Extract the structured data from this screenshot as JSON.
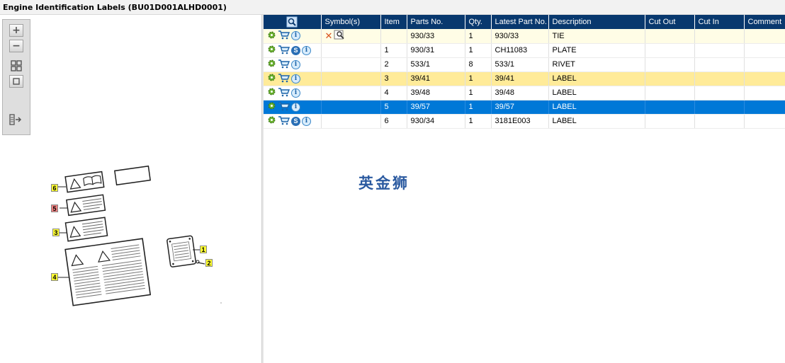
{
  "title": "Engine Identification Labels (BU01D001ALHD0001)",
  "toolbar": {
    "zoom_in_icon": "zoom-in-icon",
    "zoom_out_icon": "zoom-out-icon",
    "fit_icon": "fit-icon",
    "actual_size_icon": "actual-size-icon",
    "export_icon": "export-icon"
  },
  "diagram": {
    "callouts": [
      {
        "label": "6",
        "style": "yellow"
      },
      {
        "label": "5",
        "style": "red"
      },
      {
        "label": "3",
        "style": "yellow"
      },
      {
        "label": "4",
        "style": "yellow"
      },
      {
        "label": "1",
        "style": "yellow"
      },
      {
        "label": "2",
        "style": "yellow"
      }
    ]
  },
  "grid": {
    "columns": [
      "",
      "Symbol(s)",
      "Item",
      "Parts No.",
      "Qty.",
      "Latest Part No.",
      "Description",
      "Cut Out",
      "Cut In",
      "Comment"
    ],
    "rows": [
      {
        "style": "cream",
        "icons": [
          "gear-icon",
          "cart-icon",
          "info-icon"
        ],
        "symbols": [
          "x-icon",
          "magnifier-icon"
        ],
        "item": "",
        "parts_no": "930/33",
        "qty": "1",
        "latest_part_no": "930/33",
        "description": "TIE",
        "cut_out": "",
        "cut_in": "",
        "comment": ""
      },
      {
        "style": "normal",
        "icons": [
          "gear-icon",
          "cart-icon",
          "s-icon",
          "info-icon"
        ],
        "symbols": [],
        "item": "1",
        "parts_no": "930/31",
        "qty": "1",
        "latest_part_no": "CH11083",
        "description": "PLATE",
        "cut_out": "",
        "cut_in": "",
        "comment": ""
      },
      {
        "style": "normal",
        "icons": [
          "gear-icon",
          "cart-icon",
          "info-icon"
        ],
        "symbols": [],
        "item": "2",
        "parts_no": "533/1",
        "qty": "8",
        "latest_part_no": "533/1",
        "description": "RIVET",
        "cut_out": "",
        "cut_in": "",
        "comment": ""
      },
      {
        "style": "yellow",
        "icons": [
          "gear-icon",
          "cart-icon",
          "info-icon"
        ],
        "symbols": [],
        "item": "3",
        "parts_no": "39/41",
        "qty": "1",
        "latest_part_no": "39/41",
        "description": "LABEL",
        "cut_out": "",
        "cut_in": "",
        "comment": ""
      },
      {
        "style": "normal",
        "icons": [
          "gear-icon",
          "cart-icon",
          "info-icon"
        ],
        "symbols": [],
        "item": "4",
        "parts_no": "39/48",
        "qty": "1",
        "latest_part_no": "39/48",
        "description": "LABEL",
        "cut_out": "",
        "cut_in": "",
        "comment": ""
      },
      {
        "style": "blue",
        "icons": [
          "gear-icon",
          "cart-icon",
          "info-icon"
        ],
        "symbols": [],
        "item": "5",
        "parts_no": "39/57",
        "qty": "1",
        "latest_part_no": "39/57",
        "description": "LABEL",
        "cut_out": "",
        "cut_in": "",
        "comment": ""
      },
      {
        "style": "normal",
        "icons": [
          "gear-icon",
          "cart-icon",
          "s-icon",
          "info-icon"
        ],
        "symbols": [],
        "item": "6",
        "parts_no": "930/34",
        "qty": "1",
        "latest_part_no": "3181E003",
        "description": "LABEL",
        "cut_out": "",
        "cut_in": "",
        "comment": ""
      }
    ]
  },
  "watermark": "英金狮",
  "colors": {
    "header_bg": "#08386e",
    "selected_row": "#0078d7",
    "highlight_row": "#ffeb99",
    "cream_row": "#fffde6",
    "callout_yellow": "#ffff33",
    "callout_red": "#f08080"
  }
}
